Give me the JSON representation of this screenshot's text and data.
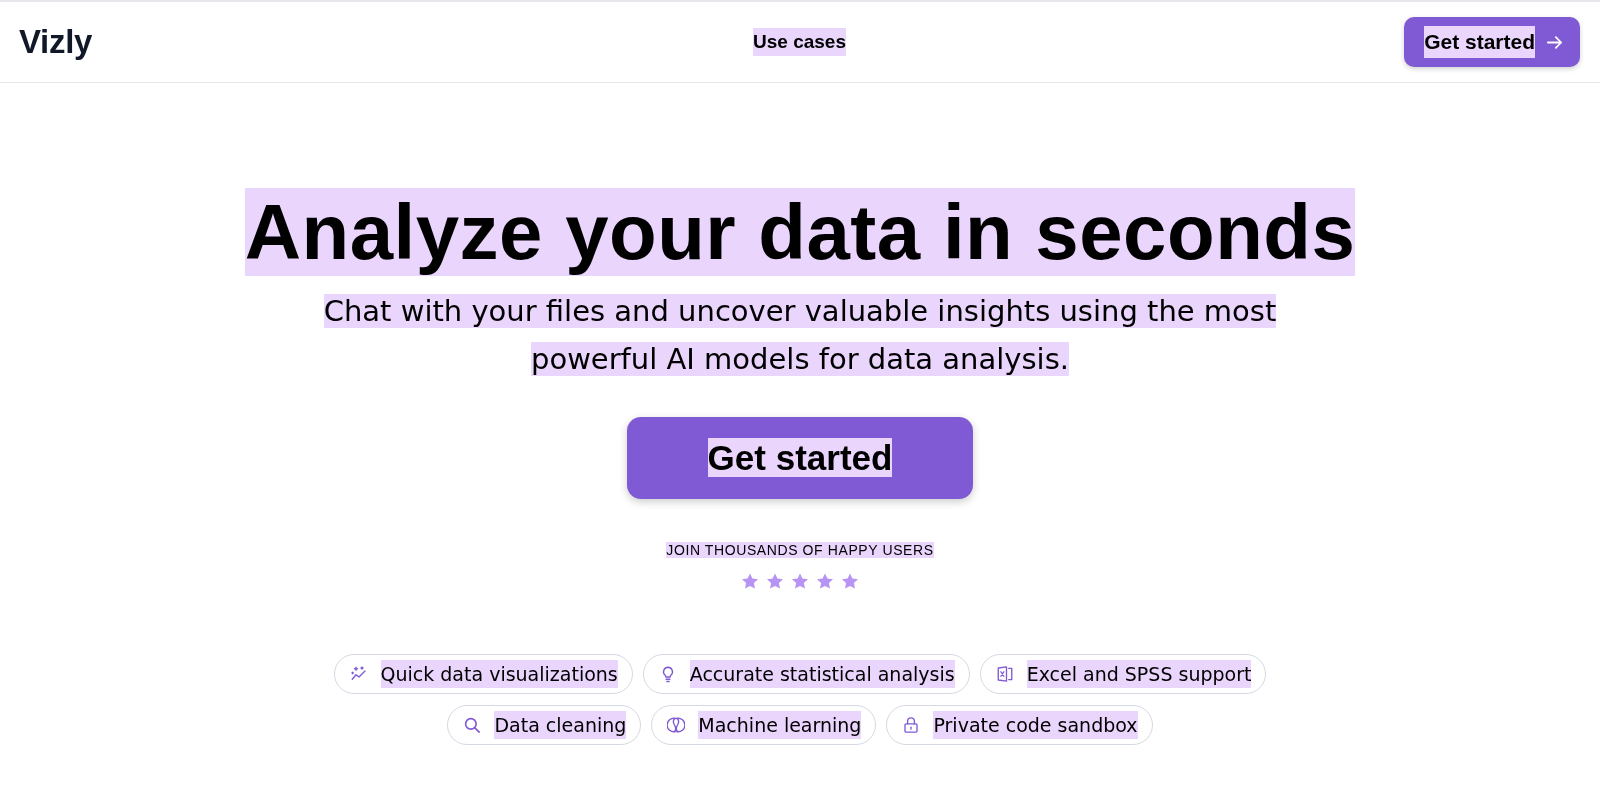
{
  "header": {
    "logo": {
      "text": "Vizly",
      "highlighted": false
    },
    "nav_links": [
      {
        "label": "Use cases",
        "highlighted": true
      }
    ],
    "cta": {
      "label": "Get started",
      "highlighted": true
    }
  },
  "hero": {
    "title": {
      "text": "Analyze your data in seconds",
      "highlighted": true
    },
    "subtitle": {
      "text": "Chat with your files and uncover valuable insights using the most powerful AI models for data analysis.",
      "highlighted": true
    },
    "cta": {
      "label": "Get started",
      "highlighted": true
    },
    "social_proof": {
      "text": "JOIN THOUSANDS OF HAPPY USERS",
      "highlighted": true
    },
    "rating": {
      "stars": 5
    }
  },
  "features": [
    [
      {
        "label": "Quick data visualizations",
        "highlighted": true
      },
      {
        "label": "Accurate statistical analysis",
        "highlighted": true
      },
      {
        "label": "Excel and SPSS support",
        "highlighted": true
      }
    ],
    [
      {
        "label": "Data cleaning",
        "highlighted": true
      },
      {
        "label": "Machine learning",
        "highlighted": true
      },
      {
        "label": "Private code sandbox",
        "highlighted": true
      }
    ]
  ]
}
